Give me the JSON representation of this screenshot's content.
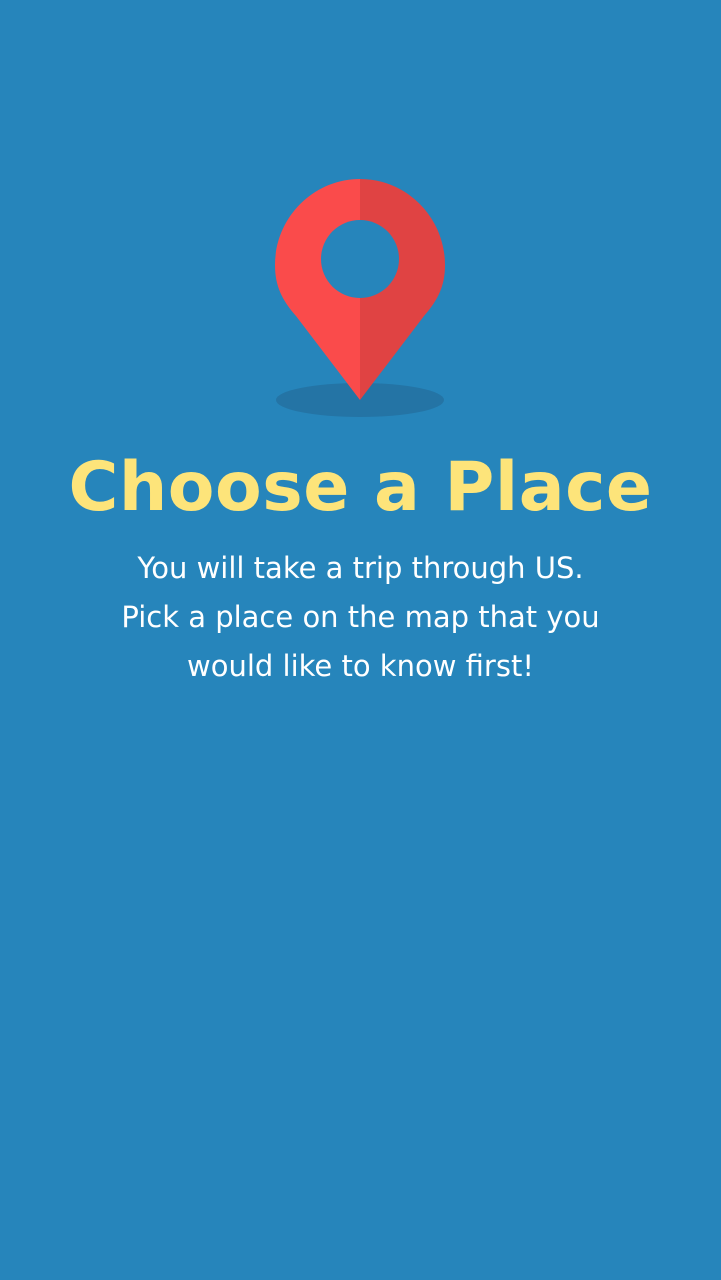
{
  "screen": {
    "background_color": "#2685bb"
  },
  "pin": {
    "icon": "map-pin-icon",
    "color_left": "#fa4b4b",
    "color_right": "#e04343",
    "hole_color": "#2685bb",
    "shadow_color": "#2474a5"
  },
  "heading": {
    "text": "Choose a Place",
    "color": "#fde47a"
  },
  "description": {
    "color": "#ffffff",
    "lines": [
      "You will take a trip through US.",
      "Pick a place on the map that you",
      "would like to know first!"
    ]
  }
}
